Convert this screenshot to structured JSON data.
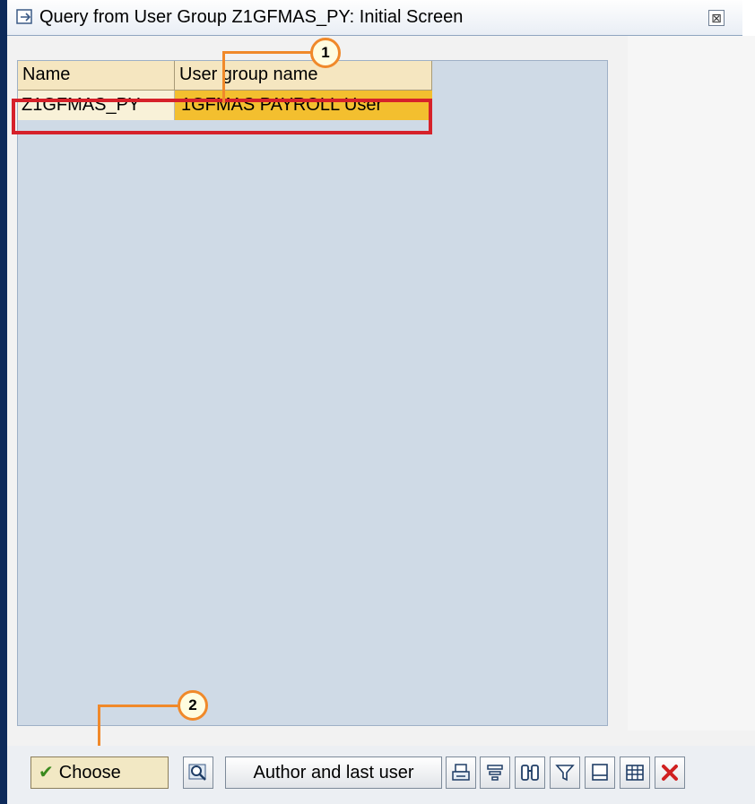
{
  "window": {
    "title": "Query from User Group Z1GFMAS_PY: Initial Screen",
    "close_glyph": "⊠"
  },
  "grid": {
    "columns": [
      "Name",
      "User group name"
    ],
    "rows": [
      {
        "name": "Z1GFMAS_PY",
        "user_group_name": "1GFMAS PAYROLL User"
      }
    ]
  },
  "callouts": {
    "step1": "1",
    "step2": "2"
  },
  "toolbar": {
    "choose_label": "Choose",
    "author_label": "Author and last user",
    "icons": [
      "search-icon",
      "print-icon",
      "sort-icon",
      "find-icon",
      "filter-icon",
      "export-icon",
      "table-icon",
      "cancel-icon"
    ]
  },
  "colors": {
    "selected_cell": "#f3bf2f",
    "highlight": "#d6212a",
    "callout": "#f0892a",
    "grid_bg": "#cfdae6"
  }
}
